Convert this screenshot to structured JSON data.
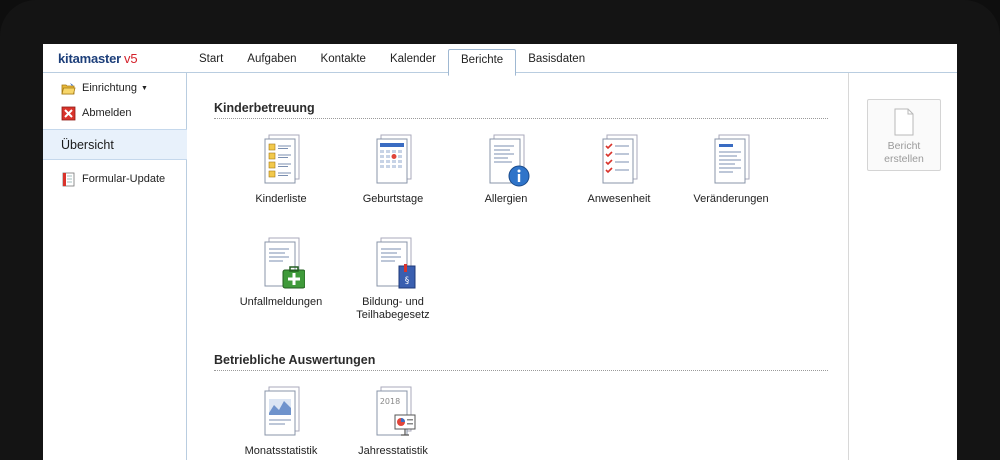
{
  "app": {
    "name": "kitamaster",
    "version": "v5"
  },
  "tabs": [
    "Start",
    "Aufgaben",
    "Kontakte",
    "Kalender",
    "Berichte",
    "Basisdaten"
  ],
  "active_tab": "Berichte",
  "sidebar": {
    "setup_label": "Einrichtung",
    "logout_label": "Abmelden",
    "overview_label": "Übersicht",
    "form_update_label": "Formular-Update"
  },
  "sections": {
    "kinder": {
      "title": "Kinderbetreuung",
      "items": [
        {
          "label": "Kinderliste",
          "icon": "children-list-icon"
        },
        {
          "label": "Geburtstage",
          "icon": "birthdays-icon"
        },
        {
          "label": "Allergien",
          "icon": "allergies-info-icon"
        },
        {
          "label": "Anwesenheit",
          "icon": "attendance-checklist-icon"
        },
        {
          "label": "Veränderungen",
          "icon": "changes-document-icon"
        },
        {
          "label": "Unfallmeldungen",
          "icon": "first-aid-kit-icon"
        },
        {
          "label": "Bildung- und Teilhabegesetz",
          "line1": "Bildung- und",
          "line2": "Teilhabegesetz",
          "icon": "law-book-icon"
        }
      ]
    },
    "betrieb": {
      "title": "Betriebliche Auswertungen",
      "items": [
        {
          "label": "Monatsstatistik",
          "icon": "monthly-chart-icon"
        },
        {
          "label": "Jahresstatistik",
          "icon": "yearly-presentation-icon",
          "year": "2018"
        }
      ]
    }
  },
  "report_button": {
    "line1": "Bericht",
    "line2": "erstellen"
  },
  "colors": {
    "brand": "#1d3f7a",
    "version": "#d4202a",
    "active_bg": "#e8f1fb"
  }
}
